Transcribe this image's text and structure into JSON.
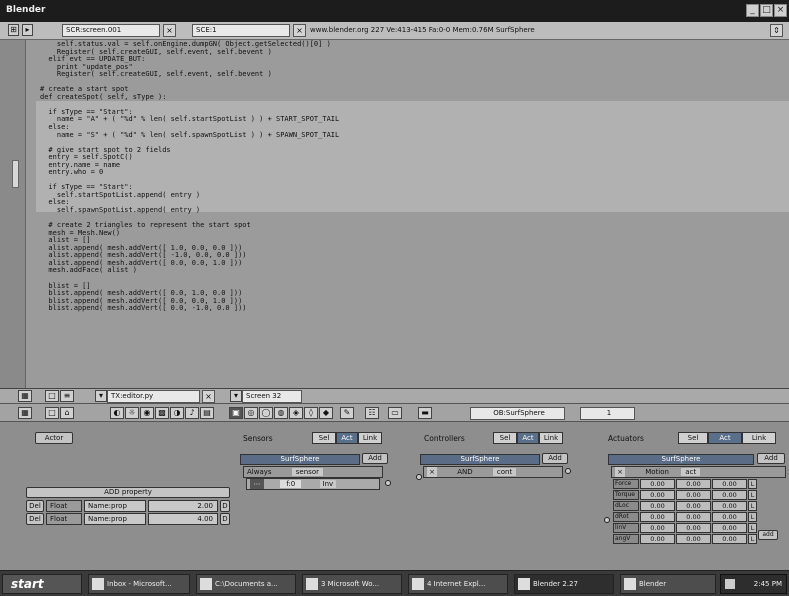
{
  "window": {
    "title": "Blender",
    "controls": [
      "_",
      "□",
      "×"
    ]
  },
  "infobar": {
    "screen_field": "SCR:screen.001",
    "scene_field": "SCE:1",
    "info_text": "www.blender.org 227 Ve:413-415 Fa:0-0  Mem:0.76M SurfSphere"
  },
  "code": {
    "lines": [
      "    self.status.val = self.onEngine.dumpGN( Object.getSelected()[0] )",
      "    Register( self.createGUI, self.event, self.bevent )",
      "  elif evt == UPDATE_BUT:",
      "    print \"update_pos\"",
      "    Register( self.createGUI, self.event, self.bevent )",
      "",
      "# create a start spot",
      "def createSpot( self, sType ):",
      "",
      "  if sType == \"Start\":",
      "    name = \"A\" + ( \"%d\" % len( self.startSpotList ) ) + START_SPOT_TAIL",
      "  else:",
      "    name = \"S\" + ( \"%d\" % len( self.spawnSpotList ) ) + SPAWN_SPOT_TAIL",
      "",
      "  # give start spot to 2 fields",
      "  entry = self.SpotC()",
      "  entry.name = name",
      "  entry.who = 0",
      "",
      "  if sType == \"Start\":",
      "    self.startSpotList.append( entry )",
      "  else:",
      "    self.spawnSpotList.append( entry )",
      "",
      "  # create 2 triangles to represent the start spot",
      "  mesh = Mesh.New()",
      "  alist = []",
      "  alist.append( mesh.addVert([ 1.0, 0.0, 0.0 ]))",
      "  alist.append( mesh.addVert([ -1.0, 0.0, 0.0 ]))",
      "  alist.append( mesh.addVert([ 0.0, 0.0, 1.0 ]))",
      "  mesh.addFace( alist )",
      "",
      "  blist = []",
      "  blist.append( mesh.addVert([ 0.0, 1.0, 0.0 ]))",
      "  blist.append( mesh.addVert([ 0.0, 0.0, 1.0 ]))",
      "  blist.append( mesh.addVert([ 0.0, -1.0, 0.0 ]))"
    ]
  },
  "text_header": {
    "file_field": "TX:editor.py",
    "screen_field": "Screen 32"
  },
  "buttons_header": {
    "object_field": "OB:SurfSphere",
    "frame_field": "1"
  },
  "logic": {
    "actor_label": "Actor",
    "add_property_label": "ADD property",
    "properties": [
      {
        "del": "Del",
        "type": "Float",
        "name": "Name:prop",
        "value": "2.00",
        "flag": "D"
      },
      {
        "del": "Del",
        "type": "Float",
        "name": "Name:prop",
        "value": "4.00",
        "flag": "D"
      }
    ],
    "sensors": {
      "title": "Sensors",
      "sel": "Sel",
      "act": "Act",
      "link": "Link",
      "object": "SurfSphere",
      "add": "Add",
      "brick_type": "Always",
      "brick_name": "sensor",
      "brick_fields": [
        "f:0",
        "Inv"
      ]
    },
    "controllers": {
      "title": "Controllers",
      "sel": "Sel",
      "act": "Act",
      "link": "Link",
      "object": "SurfSphere",
      "add": "Add",
      "brick_type": "AND",
      "brick_name": "cont"
    },
    "actuators": {
      "title": "Actuators",
      "sel": "Sel",
      "act": "Act",
      "link": "Link",
      "object": "SurfSphere",
      "add": "Add",
      "brick_type": "Motion",
      "brick_name": "act",
      "rows": [
        {
          "label": "Force",
          "values": [
            "0.00",
            "0.00",
            "0.00"
          ],
          "flag": "L"
        },
        {
          "label": "Torque",
          "values": [
            "0.00",
            "0.00",
            "0.00"
          ],
          "flag": "L"
        },
        {
          "label": "dLoc",
          "values": [
            "0.00",
            "0.00",
            "0.00"
          ],
          "flag": "L"
        },
        {
          "label": "dRot",
          "values": [
            "0.00",
            "0.00",
            "0.00"
          ],
          "flag": "L"
        },
        {
          "label": "linV",
          "values": [
            "0.00",
            "0.00",
            "0.00"
          ],
          "flag": "L"
        },
        {
          "label": "angV",
          "values": [
            "0.00",
            "0.00",
            "0.00"
          ],
          "flag": "L"
        }
      ],
      "add_label": "add"
    }
  },
  "taskbar": {
    "start_label": "start",
    "tasks": [
      "Inbox - Microsoft...",
      "C:\\Documents a...",
      "3 Microsoft Wo...",
      "4 Internet Expl...",
      "Blender 2.27",
      "Blender"
    ],
    "clock": "2:45 PM"
  },
  "colors": {
    "code_highlight": "#b1b1b1",
    "button_active": "#5a6f8a"
  }
}
